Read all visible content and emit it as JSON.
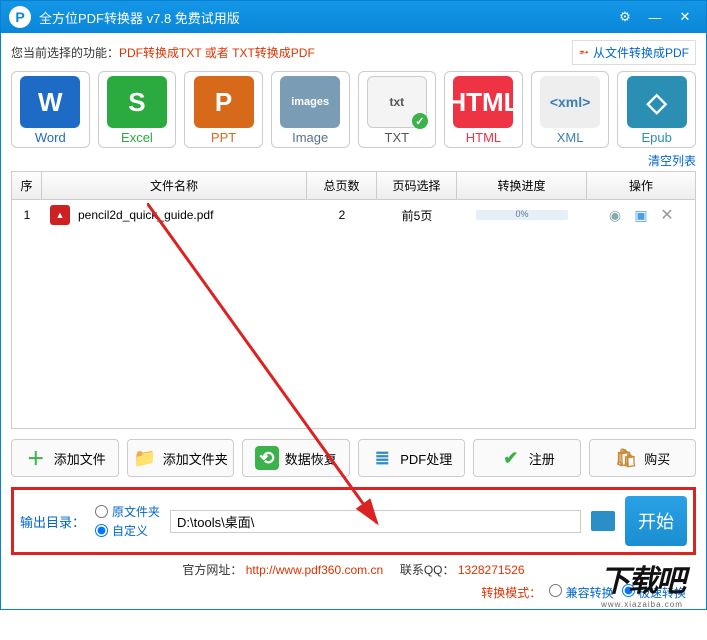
{
  "titlebar": {
    "title": "全方位PDF转换器 v7.8 免费试用版"
  },
  "row1": {
    "prefix": "您当前选择的功能：",
    "func": "PDF转换成TXT 或者 TXT转换成PDF",
    "fromfile": "从文件转换成PDF"
  },
  "formats": [
    {
      "key": "word",
      "icon": "W",
      "label": "Word"
    },
    {
      "key": "excel",
      "icon": "S",
      "label": "Excel"
    },
    {
      "key": "ppt",
      "icon": "P",
      "label": "PPT"
    },
    {
      "key": "image",
      "icon": "images",
      "label": "Image"
    },
    {
      "key": "txt",
      "icon": "txt",
      "label": "TXT"
    },
    {
      "key": "html",
      "icon": "HTML",
      "label": "HTML"
    },
    {
      "key": "xml",
      "icon": "<xml>",
      "label": "XML"
    },
    {
      "key": "epub",
      "icon": "◇",
      "label": "Epub"
    }
  ],
  "clearlist": "清空列表",
  "thead": [
    "序",
    "文件名称",
    "总页数",
    "页码选择",
    "转换进度",
    "操作"
  ],
  "rows": [
    {
      "idx": "1",
      "name": "pencil2d_quick_guide.pdf",
      "pages": "2",
      "pagesel": "前5页",
      "progress": "0%"
    }
  ],
  "actions": {
    "addfile": "添加文件",
    "addfolder": "添加文件夹",
    "recover": "数据恢复",
    "pdfproc": "PDF处理",
    "register": "注册",
    "buy": "购买"
  },
  "output": {
    "label": "输出目录：",
    "opt1": "原文件夹",
    "opt2": "自定义",
    "path": "D:\\tools\\桌面\\"
  },
  "start": "开始",
  "footer1": {
    "site_label": "官方网址：",
    "site": "http://www.pdf360.com.cn",
    "qq_label": "联系QQ：",
    "qq": "1328271526"
  },
  "footer2": {
    "mode_label": "转换模式：",
    "opt1": "兼容转换",
    "opt2": "极速转换"
  },
  "watermark": {
    "big": "下载吧",
    "small": "www.xiazaiba.com"
  }
}
